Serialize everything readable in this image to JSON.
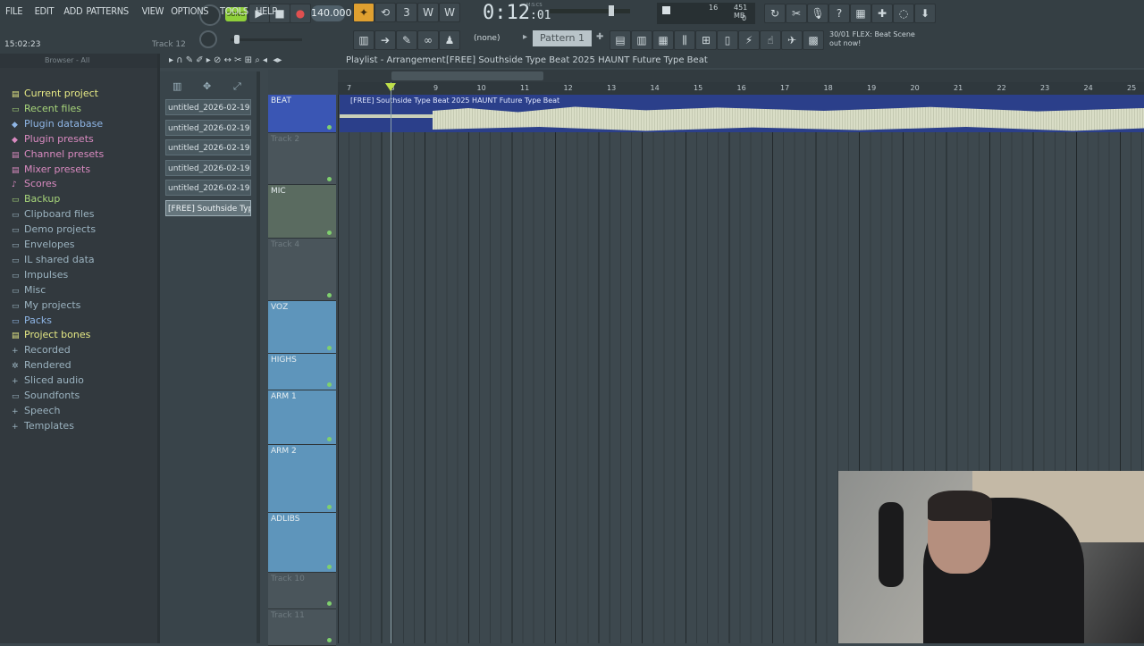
{
  "menu": [
    "FILE",
    "EDIT",
    "ADD",
    "PATTERNS",
    "VIEW",
    "OPTIONS",
    "TOOLS",
    "HELP"
  ],
  "transport": {
    "song_mode": "SONG",
    "tempo": "140.000",
    "time": "0:12",
    "time_sub": "01",
    "time_label": "M:S:CS"
  },
  "meters": {
    "cpu": "16",
    "memory": "451 MB",
    "poly": "0"
  },
  "hint": {
    "counter": "30/01",
    "text": "FLEX: Beat Scene out now!"
  },
  "clock": "15:02:23",
  "track_indicator": "Track 12",
  "pattern_selector": {
    "none": "(none)",
    "pattern": "Pattern 1"
  },
  "browser": {
    "header": "Browser - All",
    "items": [
      {
        "label": "Current project",
        "color": "#e6e985",
        "icon": "▤"
      },
      {
        "label": "Recent files",
        "color": "#a7d57a",
        "icon": "▭"
      },
      {
        "label": "Plugin database",
        "color": "#8fb6e6",
        "icon": "◆"
      },
      {
        "label": "Plugin presets",
        "color": "#d98ac0",
        "icon": "◆"
      },
      {
        "label": "Channel presets",
        "color": "#d98ac0",
        "icon": "▤"
      },
      {
        "label": "Mixer presets",
        "color": "#d98ac0",
        "icon": "▤"
      },
      {
        "label": "Scores",
        "color": "#d98ac0",
        "icon": "♪"
      },
      {
        "label": "Backup",
        "color": "#a7d57a",
        "icon": "▭"
      },
      {
        "label": "Clipboard files",
        "color": "#9bb3c0",
        "icon": "▭"
      },
      {
        "label": "Demo projects",
        "color": "#9bb3c0",
        "icon": "▭"
      },
      {
        "label": "Envelopes",
        "color": "#9bb3c0",
        "icon": "▭"
      },
      {
        "label": "IL shared data",
        "color": "#9bb3c0",
        "icon": "▭"
      },
      {
        "label": "Impulses",
        "color": "#9bb3c0",
        "icon": "▭"
      },
      {
        "label": "Misc",
        "color": "#9bb3c0",
        "icon": "▭"
      },
      {
        "label": "My projects",
        "color": "#9bb3c0",
        "icon": "▭"
      },
      {
        "label": "Packs",
        "color": "#8fb6e6",
        "icon": "▭"
      },
      {
        "label": "Project bones",
        "color": "#e6e985",
        "icon": "▤"
      },
      {
        "label": "Recorded",
        "color": "#9bb3c0",
        "icon": "+"
      },
      {
        "label": "Rendered",
        "color": "#9bb3c0",
        "icon": "✲"
      },
      {
        "label": "Sliced audio",
        "color": "#9bb3c0",
        "icon": "+"
      },
      {
        "label": "Soundfonts",
        "color": "#9bb3c0",
        "icon": "▭"
      },
      {
        "label": "Speech",
        "color": "#9bb3c0",
        "icon": "+"
      },
      {
        "label": "Templates",
        "color": "#9bb3c0",
        "icon": "+"
      }
    ]
  },
  "patterns": [
    "untitled_2026-02-19 20-...",
    "untitled_2026-02-19 20-...",
    "untitled_2026-02-19 20-...",
    "untitled_2026-02-19 20-...",
    "untitled_2026-02-19 20-...",
    "[FREE] Southside Typ..."
  ],
  "playlist": {
    "title": "Playlist - Arrangement",
    "breadcrumb": "[FREE] Southside Type Beat 2025 HAUNT Future Type Beat",
    "clip_title": "[FREE] Southside Type Beat 2025 HAUNT Future Type Beat",
    "ruler": [
      "7",
      "8",
      "9",
      "10",
      "11",
      "12",
      "13",
      "14",
      "15",
      "16",
      "17",
      "18",
      "19",
      "20",
      "21",
      "22",
      "23",
      "24",
      "25"
    ]
  },
  "tracks": [
    {
      "name": "BEAT",
      "color": "#3a56b4"
    },
    {
      "name": "Track 2",
      "color": "#4a555b"
    },
    {
      "name": "MIC",
      "color": "#5a6b60"
    },
    {
      "name": "Track 4",
      "color": "#4a555b"
    },
    {
      "name": "VOZ",
      "color": "#5e95bb"
    },
    {
      "name": "HIGHS",
      "color": "#5e95bb"
    },
    {
      "name": "ARM 1",
      "color": "#5e95bb"
    },
    {
      "name": "ARM 2",
      "color": "#5e95bb"
    },
    {
      "name": "ADLIBS",
      "color": "#5e95bb"
    },
    {
      "name": "Track 10",
      "color": "#4a555b"
    },
    {
      "name": "Track 11",
      "color": "#4a555b"
    }
  ]
}
